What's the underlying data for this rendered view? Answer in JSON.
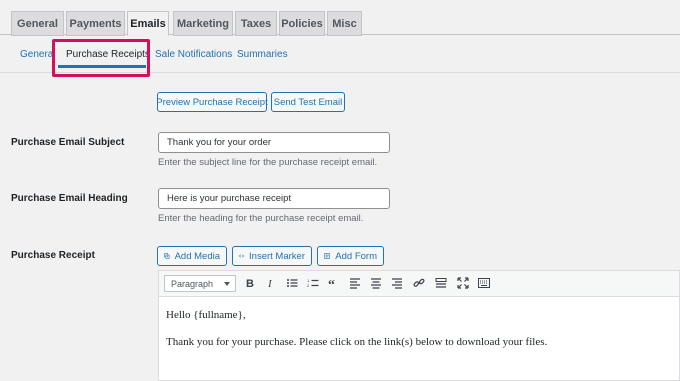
{
  "top_tabs": [
    "General",
    "Payments",
    "Emails",
    "Marketing",
    "Taxes",
    "Policies",
    "Misc"
  ],
  "active_top_tab": "Emails",
  "subnav": [
    "General",
    "Purchase Receipts",
    "Sale Notifications",
    "Summaries"
  ],
  "active_subnav": "Purchase Receipts",
  "actions": {
    "preview": "Preview Purchase Receipt",
    "send_test": "Send Test Email"
  },
  "subject": {
    "label": "Purchase Email Subject",
    "value": "Thank you for your order",
    "description": "Enter the subject line for the purchase receipt email."
  },
  "heading": {
    "label": "Purchase Email Heading",
    "value": "Here is your purchase receipt",
    "description": "Enter the heading for the purchase receipt email."
  },
  "receipt": {
    "label": "Purchase Receipt",
    "add_media": "Add Media",
    "insert_marker": "Insert Marker",
    "add_form": "Add Form",
    "format": "Paragraph",
    "toolbar_icons": [
      "bold-icon",
      "italic-icon",
      "bullet-list-icon",
      "numbered-list-icon",
      "blockquote-icon",
      "align-left-icon",
      "align-center-icon",
      "align-right-icon",
      "link-icon",
      "horizontal-rule-icon",
      "fullscreen-icon",
      "toolbar-toggle-icon"
    ],
    "content": [
      "Hello {fullname},",
      "Thank you for your purchase. Please click on the link(s) below to download your files."
    ]
  },
  "colors": {
    "accent": "#2271b1",
    "highlight": "#d40f5d"
  }
}
